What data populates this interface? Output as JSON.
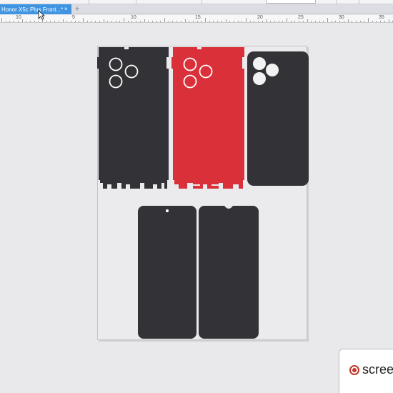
{
  "tab": {
    "title": "Honor X5c Plus Front...*",
    "close": "×",
    "add": "+"
  },
  "ruler": {
    "labels": [
      "10",
      "5",
      "10",
      "15",
      "20",
      "25",
      "30",
      "35"
    ]
  },
  "watermark": {
    "brand_text": "scree"
  },
  "icons": {
    "cursor": "arrow-cursor-icon",
    "close": "close-icon",
    "add": "plus-icon",
    "brand": "record-icon"
  },
  "colors": {
    "skin_black": "#333337",
    "skin_red": "#d93039",
    "tab_active": "#3f95e2",
    "brand_red": "#c0392b"
  }
}
